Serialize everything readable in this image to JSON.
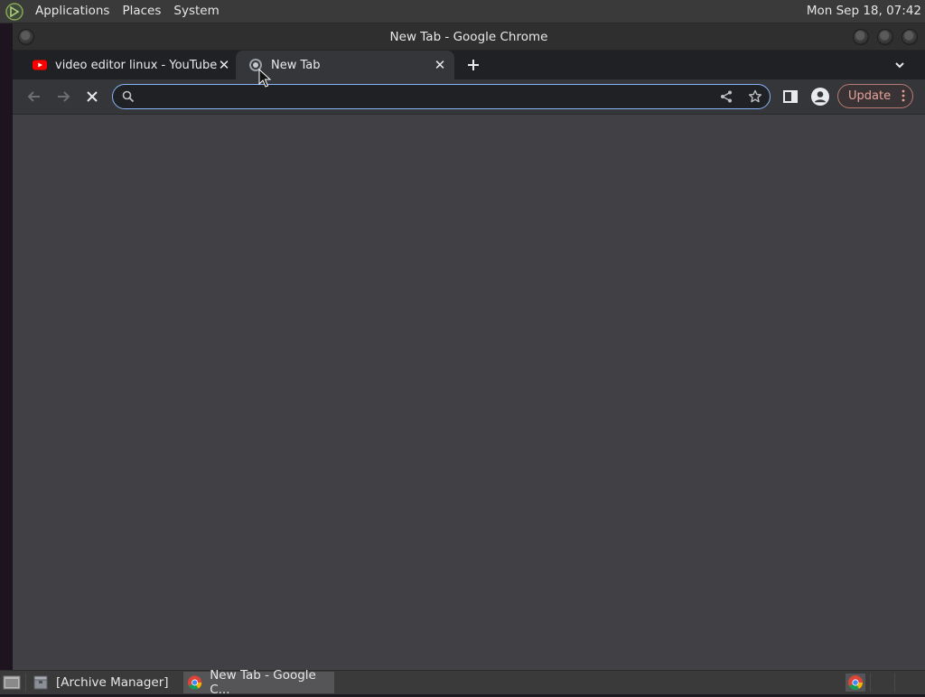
{
  "top_panel": {
    "menus": [
      "Applications",
      "Places",
      "System"
    ],
    "clock": "Mon Sep 18, 07:42"
  },
  "window": {
    "title": "New Tab - Google Chrome"
  },
  "tabs": [
    {
      "title": "video editor linux - YouTube",
      "favicon": "youtube-icon",
      "active": false
    },
    {
      "title": "New Tab",
      "favicon": "loading-spinner-icon",
      "active": true
    }
  ],
  "toolbar": {
    "address_value": "",
    "update_label": "Update"
  },
  "taskbar": {
    "items": [
      {
        "label": "[Archive Manager]",
        "icon": "archive-manager-icon"
      },
      {
        "label": "New Tab - Google C...",
        "icon": "chrome-icon",
        "active": true
      }
    ]
  },
  "colors": {
    "accent_focus": "#8ab4f8",
    "update_text": "#e6a399",
    "content_bg": "#414145"
  }
}
